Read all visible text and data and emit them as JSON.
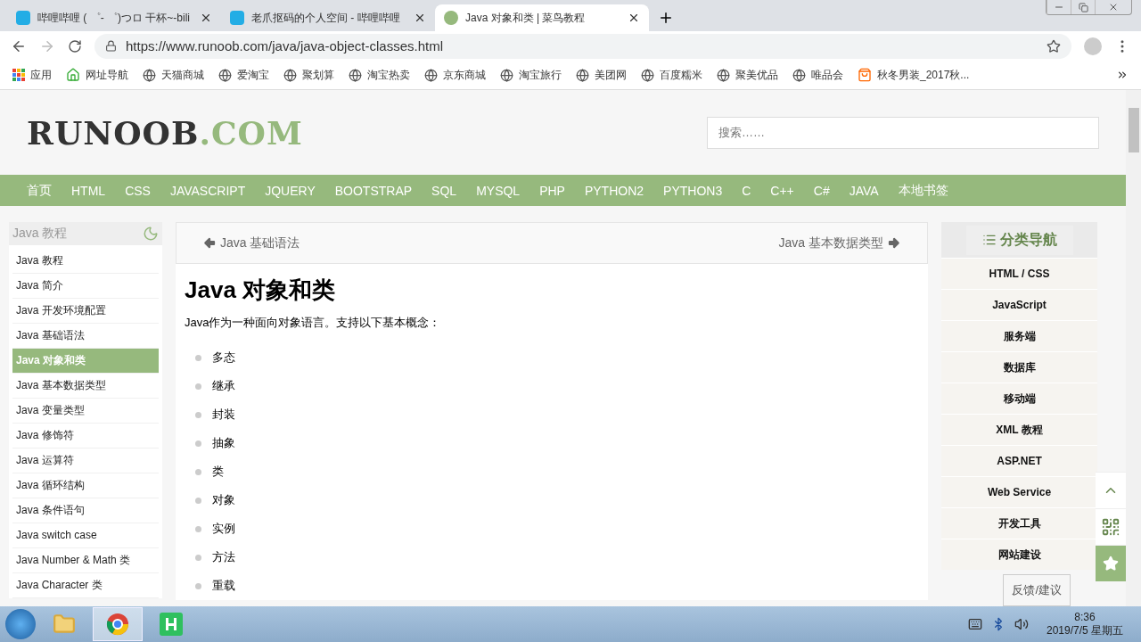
{
  "browser": {
    "tabs": [
      {
        "title": "哔哩哔哩 ( ゜- ゜)つロ 干杯~-bili",
        "kind": "bili",
        "selected": false
      },
      {
        "title": "老爪抠码的个人空间 - 哔哩哔哩",
        "kind": "bili",
        "selected": false
      },
      {
        "title": "Java 对象和类 | 菜鸟教程",
        "kind": "runoob",
        "selected": true
      }
    ],
    "url": "https://www.runoob.com/java/java-object-classes.html",
    "bookmarks": [
      {
        "label": "应用",
        "kind": "apps"
      },
      {
        "label": "网址导航",
        "kind": "home"
      },
      {
        "label": "天猫商城",
        "kind": "globe"
      },
      {
        "label": "爱淘宝",
        "kind": "globe"
      },
      {
        "label": "聚划算",
        "kind": "globe"
      },
      {
        "label": "淘宝热卖",
        "kind": "globe"
      },
      {
        "label": "京东商城",
        "kind": "globe"
      },
      {
        "label": "淘宝旅行",
        "kind": "globe"
      },
      {
        "label": "美团网",
        "kind": "globe"
      },
      {
        "label": "百度糯米",
        "kind": "globe"
      },
      {
        "label": "聚美优品",
        "kind": "globe"
      },
      {
        "label": "唯品会",
        "kind": "globe"
      },
      {
        "label": "秋冬男装_2017秋...",
        "kind": "shop"
      }
    ]
  },
  "site": {
    "logo": {
      "main": "RUNOOB",
      "accent": ".COM"
    },
    "search": {
      "placeholder": "搜索……"
    },
    "nav": [
      "首页",
      "HTML",
      "CSS",
      "JAVASCRIPT",
      "JQUERY",
      "BOOTSTRAP",
      "SQL",
      "MYSQL",
      "PHP",
      "PYTHON2",
      "PYTHON3",
      "C",
      "C++",
      "C#",
      "JAVA",
      "本地书签"
    ],
    "sidebar": {
      "title": "Java 教程",
      "items": [
        {
          "label": "Java 教程",
          "selected": false
        },
        {
          "label": "Java 简介",
          "selected": false
        },
        {
          "label": "Java 开发环境配置",
          "selected": false
        },
        {
          "label": "Java 基础语法",
          "selected": false
        },
        {
          "label": "Java 对象和类",
          "selected": true
        },
        {
          "label": "Java 基本数据类型",
          "selected": false
        },
        {
          "label": "Java 变量类型",
          "selected": false
        },
        {
          "label": "Java 修饰符",
          "selected": false
        },
        {
          "label": "Java 运算符",
          "selected": false
        },
        {
          "label": "Java 循环结构",
          "selected": false
        },
        {
          "label": "Java 条件语句",
          "selected": false
        },
        {
          "label": "Java switch case",
          "selected": false
        },
        {
          "label": "Java Number & Math 类",
          "selected": false
        },
        {
          "label": "Java Character 类",
          "selected": false
        }
      ]
    },
    "article": {
      "prev": "Java 基础语法",
      "next": "Java 基本数据类型",
      "title": "Java 对象和类",
      "intro": "Java作为一种面向对象语言。支持以下基本概念：",
      "concepts": [
        "多态",
        "继承",
        "封装",
        "抽象",
        "类",
        "对象",
        "实例",
        "方法",
        "重载"
      ]
    },
    "category_nav": {
      "title": "分类导航",
      "items": [
        "HTML / CSS",
        "JavaScript",
        "服务端",
        "数据库",
        "移动端",
        "XML 教程",
        "ASP.NET",
        "Web Service",
        "开发工具",
        "网站建设"
      ]
    },
    "feedback": "反馈/建议"
  },
  "taskbar": {
    "apps": [
      {
        "kind": "folder",
        "selected": false
      },
      {
        "kind": "chrome",
        "selected": true
      },
      {
        "kind": "editor",
        "selected": false
      }
    ],
    "time": "8:36",
    "date": "2019/7/5 星期五"
  }
}
